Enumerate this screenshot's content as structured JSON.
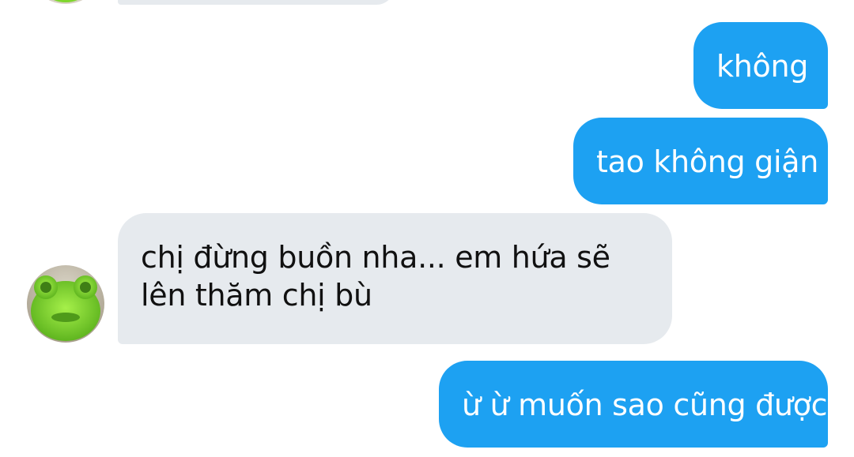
{
  "conversation": {
    "messages": [
      {
        "sender": "me",
        "text": "không"
      },
      {
        "sender": "me",
        "text": "tao không giận"
      },
      {
        "sender": "other",
        "text": "chị đừng buồn nha... em hứa sẽ lên thăm chị bù"
      },
      {
        "sender": "me",
        "text": "ừ ừ muốn sao cũng được"
      }
    ]
  },
  "colors": {
    "sent_bubble": "#1da1f2",
    "received_bubble": "#e6eaee"
  },
  "avatar_icon": "green-frog-plush-icon"
}
